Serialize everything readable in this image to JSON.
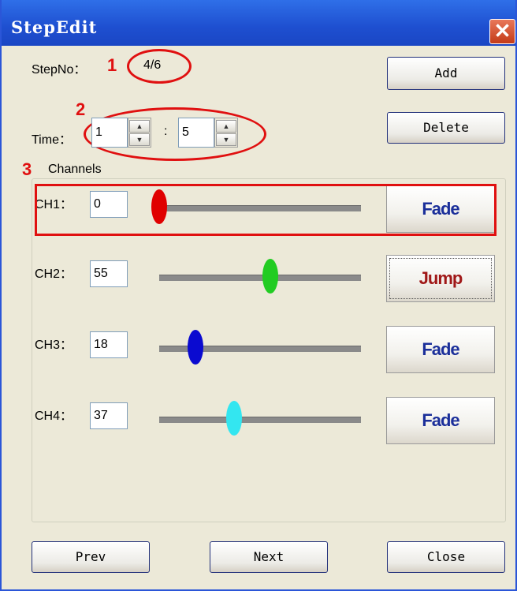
{
  "window": {
    "title": "StepEdit",
    "close_glyph": "✕"
  },
  "step": {
    "label": "StepNo：",
    "value": "4/6"
  },
  "time": {
    "label": "Time：",
    "first": "1",
    "separator": ":",
    "second": "5"
  },
  "buttons": {
    "add": "Add",
    "delete": "Delete",
    "prev": "Prev",
    "next": "Next",
    "close": "Close"
  },
  "channels": {
    "group_label": "Channels",
    "items": [
      {
        "label": "CH1：",
        "value": "0",
        "level": 0,
        "mode": "Fade",
        "knob_color": "#e00000",
        "mode_color": "#1b2f9a"
      },
      {
        "label": "CH2：",
        "value": "55",
        "level": 55,
        "mode": "Jump",
        "knob_color": "#22cc22",
        "mode_color": "#a01818"
      },
      {
        "label": "CH3：",
        "value": "18",
        "level": 18,
        "mode": "Fade",
        "knob_color": "#0a0ad0",
        "mode_color": "#1b2f9a"
      },
      {
        "label": "CH4：",
        "value": "37",
        "level": 37,
        "mode": "Fade",
        "knob_color": "#33e6f0",
        "mode_color": "#1b2f9a"
      }
    ]
  },
  "annotations": {
    "marker1": "1",
    "marker2": "2",
    "marker3": "3",
    "color": "#e01010"
  }
}
